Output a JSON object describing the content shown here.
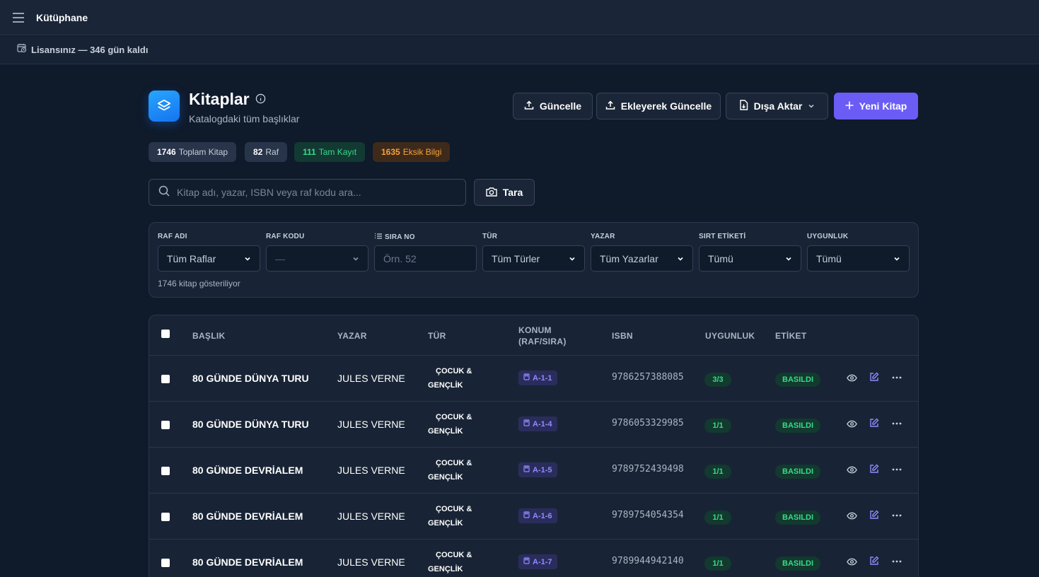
{
  "topbar": {
    "title": "Kütüphane",
    "menu_icon": "hamburger-menu-icon"
  },
  "license": {
    "text": "Lisansınız — 346 gün kaldı",
    "icon": "calendar-clock-icon"
  },
  "header": {
    "title": "Kitaplar",
    "subtitle": "Katalogdaki tüm başlıklar",
    "icon": "layers-icon",
    "buttons": {
      "update": "Güncelle",
      "append_update": "Ekleyerek Güncelle",
      "export": "Dışa Aktar",
      "new_book": "Yeni Kitap"
    }
  },
  "stats": [
    {
      "value": "1746",
      "label": "Toplam Kitap"
    },
    {
      "value": "82",
      "label": "Raf"
    },
    {
      "value": "111",
      "label": "Tam Kayıt"
    },
    {
      "value": "1635",
      "label": "Eksik Bilgi"
    }
  ],
  "search": {
    "placeholder": "Kitap adı, yazar, ISBN veya raf kodu ara...",
    "value": "",
    "scan_label": "Tara"
  },
  "filters": {
    "labels": [
      "RAF ADI",
      "RAF KODU",
      "SIRA NO",
      "TÜR",
      "YAZAR",
      "SIRT ETİKETİ",
      "UYGUNLUK"
    ],
    "values": [
      "Tüm Raflar",
      "—",
      "",
      "Tüm Türler",
      "Tüm Yazarlar",
      "Tümü",
      "Tümü"
    ],
    "sira_placeholder": "Örn. 52",
    "count_note": "1746 kitap gösteriliyor"
  },
  "table": {
    "headers": [
      "BAŞLIK",
      "YAZAR",
      "TÜR",
      "KONUM",
      "(RAF/SIRA)",
      "ISBN",
      "UYGUNLUK",
      "ETİKET"
    ],
    "rows": [
      {
        "title": "80 GÜNDE DÜNYA TURU",
        "author": "JULES VERNE",
        "genre1": "ÇOCUK &",
        "genre2": "GENÇLİK",
        "location": "A-1-1",
        "isbn": "9786257388085",
        "availability": "3/3",
        "tag": "BASILDI"
      },
      {
        "title": "80 GÜNDE DÜNYA TURU",
        "author": "JULES VERNE",
        "genre1": "ÇOCUK &",
        "genre2": "GENÇLİK",
        "location": "A-1-4",
        "isbn": "9786053329985",
        "availability": "1/1",
        "tag": "BASILDI"
      },
      {
        "title": "80 GÜNDE DEVRİALEM",
        "author": "JULES VERNE",
        "genre1": "ÇOCUK &",
        "genre2": "GENÇLİK",
        "location": "A-1-5",
        "isbn": "9789752439498",
        "availability": "1/1",
        "tag": "BASILDI"
      },
      {
        "title": "80 GÜNDE DEVRİALEM",
        "author": "JULES VERNE",
        "genre1": "ÇOCUK &",
        "genre2": "GENÇLİK",
        "location": "A-1-6",
        "isbn": "9789754054354",
        "availability": "1/1",
        "tag": "BASILDI"
      },
      {
        "title": "80 GÜNDE DEVRİALEM",
        "author": "JULES VERNE",
        "genre1": "ÇOCUK &",
        "genre2": "GENÇLİK",
        "location": "A-1-7",
        "isbn": "9789944942140",
        "availability": "1/1",
        "tag": "BASILDI"
      }
    ]
  },
  "colors": {
    "background": "#0f1a2b",
    "accent": "#6b5cf6",
    "success": "#39d98a",
    "warning": "#f7a23b",
    "location": "#8f8bff"
  }
}
